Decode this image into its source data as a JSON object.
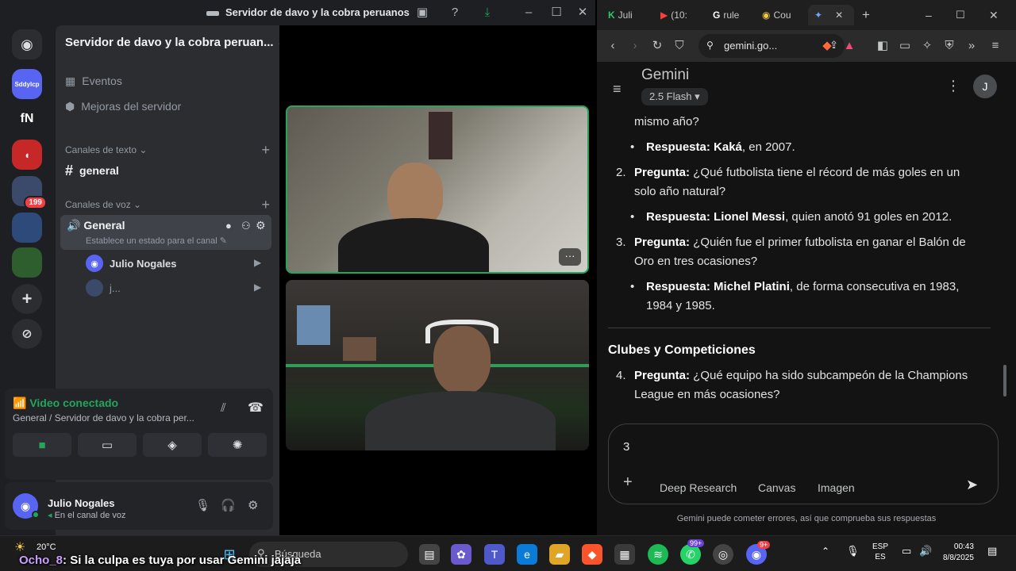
{
  "discord": {
    "window_title": "Servidor de davo y la cobra peruanos",
    "guild_labels": [
      "Sddylcp",
      "fN"
    ],
    "guild_badge": "199",
    "server_name": "Servidor de davo y la cobra peruan...",
    "menu": [
      "Eventos",
      "Mejoras del servidor"
    ],
    "text_category": "Canales de texto",
    "text_channel": "general",
    "voice_category": "Canales de voz",
    "voice_channel": "General",
    "voice_status_hint": "Establece un estado para el canal",
    "voice_users": [
      "Julio Nogales",
      "j..."
    ],
    "voice_connected": "Video conectado",
    "voice_location": "General / Servidor de davo y la cobra per...",
    "user_name": "Julio Nogales",
    "user_status": "En el canal de voz",
    "colors": {
      "accent": "#5865f2",
      "green": "#23a55a",
      "red": "#f23f43"
    }
  },
  "browser": {
    "tabs": [
      "Juli",
      "(10:",
      "rule",
      "Cou"
    ],
    "url": "gemini.go...",
    "app_name": "Gemini",
    "model": "2.5 Flash",
    "avatar_initial": "J",
    "lead_text": "mismo año?",
    "items": [
      {
        "answer_label": "Respuesta:",
        "answer_bold": "Kaká",
        "answer_rest": ", en 2007."
      },
      {
        "num": "2.",
        "q_label": "Pregunta:",
        "question": " ¿Qué futbolista tiene el récord de más goles en un solo año natural?",
        "answer_label": "Respuesta:",
        "answer_bold": "Lionel Messi",
        "answer_rest": ", quien anotó 91 goles en 2012."
      },
      {
        "num": "3.",
        "q_label": "Pregunta:",
        "question": " ¿Quién fue el primer futbolista en ganar el Balón de Oro en tres ocasiones?",
        "answer_label": "Respuesta:",
        "answer_bold": "Michel Platini",
        "answer_rest": ", de forma consecutiva en 1983, 1984 y 1985."
      },
      {
        "num": "4.",
        "q_label": "Pregunta:",
        "question": " ¿Qué equipo ha sido subcampeón de la Champions League en más ocasiones?"
      }
    ],
    "section_heading": "Clubes y Competiciones",
    "input_value": "3",
    "input_tools": [
      "Deep Research",
      "Canvas",
      "Imagen"
    ],
    "disclaimer": "Gemini puede cometer errores, así que comprueba sus respuestas"
  },
  "taskbar": {
    "weather": "20°C",
    "search_placeholder": "Búsqueda",
    "badge_whatsapp": "99+",
    "badge_discord": "9+",
    "lang": "ESP",
    "lang_sub": "ES",
    "time": "00:43",
    "date": "8/8/2025"
  },
  "overlay": {
    "nick": "Ocho_8",
    "message": ": Si la culpa es tuya por usar Gemini jajaja"
  }
}
